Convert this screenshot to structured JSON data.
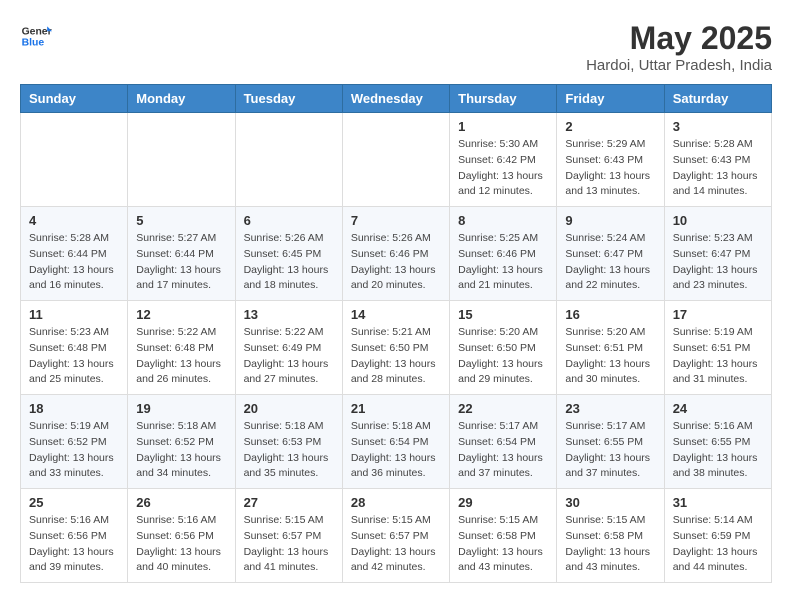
{
  "header": {
    "logo_line1": "General",
    "logo_line2": "Blue",
    "month_year": "May 2025",
    "location": "Hardoi, Uttar Pradesh, India"
  },
  "weekdays": [
    "Sunday",
    "Monday",
    "Tuesday",
    "Wednesday",
    "Thursday",
    "Friday",
    "Saturday"
  ],
  "weeks": [
    [
      {
        "day": "",
        "info": ""
      },
      {
        "day": "",
        "info": ""
      },
      {
        "day": "",
        "info": ""
      },
      {
        "day": "",
        "info": ""
      },
      {
        "day": "1",
        "info": "Sunrise: 5:30 AM\nSunset: 6:42 PM\nDaylight: 13 hours\nand 12 minutes."
      },
      {
        "day": "2",
        "info": "Sunrise: 5:29 AM\nSunset: 6:43 PM\nDaylight: 13 hours\nand 13 minutes."
      },
      {
        "day": "3",
        "info": "Sunrise: 5:28 AM\nSunset: 6:43 PM\nDaylight: 13 hours\nand 14 minutes."
      }
    ],
    [
      {
        "day": "4",
        "info": "Sunrise: 5:28 AM\nSunset: 6:44 PM\nDaylight: 13 hours\nand 16 minutes."
      },
      {
        "day": "5",
        "info": "Sunrise: 5:27 AM\nSunset: 6:44 PM\nDaylight: 13 hours\nand 17 minutes."
      },
      {
        "day": "6",
        "info": "Sunrise: 5:26 AM\nSunset: 6:45 PM\nDaylight: 13 hours\nand 18 minutes."
      },
      {
        "day": "7",
        "info": "Sunrise: 5:26 AM\nSunset: 6:46 PM\nDaylight: 13 hours\nand 20 minutes."
      },
      {
        "day": "8",
        "info": "Sunrise: 5:25 AM\nSunset: 6:46 PM\nDaylight: 13 hours\nand 21 minutes."
      },
      {
        "day": "9",
        "info": "Sunrise: 5:24 AM\nSunset: 6:47 PM\nDaylight: 13 hours\nand 22 minutes."
      },
      {
        "day": "10",
        "info": "Sunrise: 5:23 AM\nSunset: 6:47 PM\nDaylight: 13 hours\nand 23 minutes."
      }
    ],
    [
      {
        "day": "11",
        "info": "Sunrise: 5:23 AM\nSunset: 6:48 PM\nDaylight: 13 hours\nand 25 minutes."
      },
      {
        "day": "12",
        "info": "Sunrise: 5:22 AM\nSunset: 6:48 PM\nDaylight: 13 hours\nand 26 minutes."
      },
      {
        "day": "13",
        "info": "Sunrise: 5:22 AM\nSunset: 6:49 PM\nDaylight: 13 hours\nand 27 minutes."
      },
      {
        "day": "14",
        "info": "Sunrise: 5:21 AM\nSunset: 6:50 PM\nDaylight: 13 hours\nand 28 minutes."
      },
      {
        "day": "15",
        "info": "Sunrise: 5:20 AM\nSunset: 6:50 PM\nDaylight: 13 hours\nand 29 minutes."
      },
      {
        "day": "16",
        "info": "Sunrise: 5:20 AM\nSunset: 6:51 PM\nDaylight: 13 hours\nand 30 minutes."
      },
      {
        "day": "17",
        "info": "Sunrise: 5:19 AM\nSunset: 6:51 PM\nDaylight: 13 hours\nand 31 minutes."
      }
    ],
    [
      {
        "day": "18",
        "info": "Sunrise: 5:19 AM\nSunset: 6:52 PM\nDaylight: 13 hours\nand 33 minutes."
      },
      {
        "day": "19",
        "info": "Sunrise: 5:18 AM\nSunset: 6:52 PM\nDaylight: 13 hours\nand 34 minutes."
      },
      {
        "day": "20",
        "info": "Sunrise: 5:18 AM\nSunset: 6:53 PM\nDaylight: 13 hours\nand 35 minutes."
      },
      {
        "day": "21",
        "info": "Sunrise: 5:18 AM\nSunset: 6:54 PM\nDaylight: 13 hours\nand 36 minutes."
      },
      {
        "day": "22",
        "info": "Sunrise: 5:17 AM\nSunset: 6:54 PM\nDaylight: 13 hours\nand 37 minutes."
      },
      {
        "day": "23",
        "info": "Sunrise: 5:17 AM\nSunset: 6:55 PM\nDaylight: 13 hours\nand 37 minutes."
      },
      {
        "day": "24",
        "info": "Sunrise: 5:16 AM\nSunset: 6:55 PM\nDaylight: 13 hours\nand 38 minutes."
      }
    ],
    [
      {
        "day": "25",
        "info": "Sunrise: 5:16 AM\nSunset: 6:56 PM\nDaylight: 13 hours\nand 39 minutes."
      },
      {
        "day": "26",
        "info": "Sunrise: 5:16 AM\nSunset: 6:56 PM\nDaylight: 13 hours\nand 40 minutes."
      },
      {
        "day": "27",
        "info": "Sunrise: 5:15 AM\nSunset: 6:57 PM\nDaylight: 13 hours\nand 41 minutes."
      },
      {
        "day": "28",
        "info": "Sunrise: 5:15 AM\nSunset: 6:57 PM\nDaylight: 13 hours\nand 42 minutes."
      },
      {
        "day": "29",
        "info": "Sunrise: 5:15 AM\nSunset: 6:58 PM\nDaylight: 13 hours\nand 43 minutes."
      },
      {
        "day": "30",
        "info": "Sunrise: 5:15 AM\nSunset: 6:58 PM\nDaylight: 13 hours\nand 43 minutes."
      },
      {
        "day": "31",
        "info": "Sunrise: 5:14 AM\nSunset: 6:59 PM\nDaylight: 13 hours\nand 44 minutes."
      }
    ]
  ]
}
